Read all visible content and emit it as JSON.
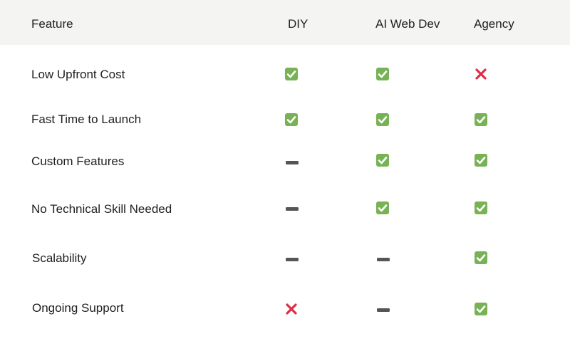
{
  "header": {
    "feature": "Feature",
    "diy": "DIY",
    "ai_web_dev": "AI Web Dev",
    "agency": "Agency"
  },
  "colors": {
    "header_bg": "#f4f4f2",
    "yes": "#77b255",
    "no": "#dd2e44",
    "partial": "#555555"
  },
  "rows": [
    {
      "label": "Low Upfront Cost",
      "diy": "yes",
      "ai_web_dev": "yes",
      "agency": "no"
    },
    {
      "label": "Fast Time to Launch",
      "diy": "yes",
      "ai_web_dev": "yes",
      "agency": "yes"
    },
    {
      "label": "Custom Features",
      "diy": "partial",
      "ai_web_dev": "yes",
      "agency": "yes"
    },
    {
      "label": "No Technical Skill Needed",
      "diy": "partial",
      "ai_web_dev": "yes",
      "agency": "yes"
    },
    {
      "label": "Scalability",
      "diy": "partial",
      "ai_web_dev": "partial",
      "agency": "yes"
    },
    {
      "label": "Ongoing Support",
      "diy": "no",
      "ai_web_dev": "partial",
      "agency": "yes"
    }
  ],
  "icons": {
    "yes": "check-mark-button-icon",
    "no": "cross-mark-icon",
    "partial": "heavy-minus-icon"
  }
}
